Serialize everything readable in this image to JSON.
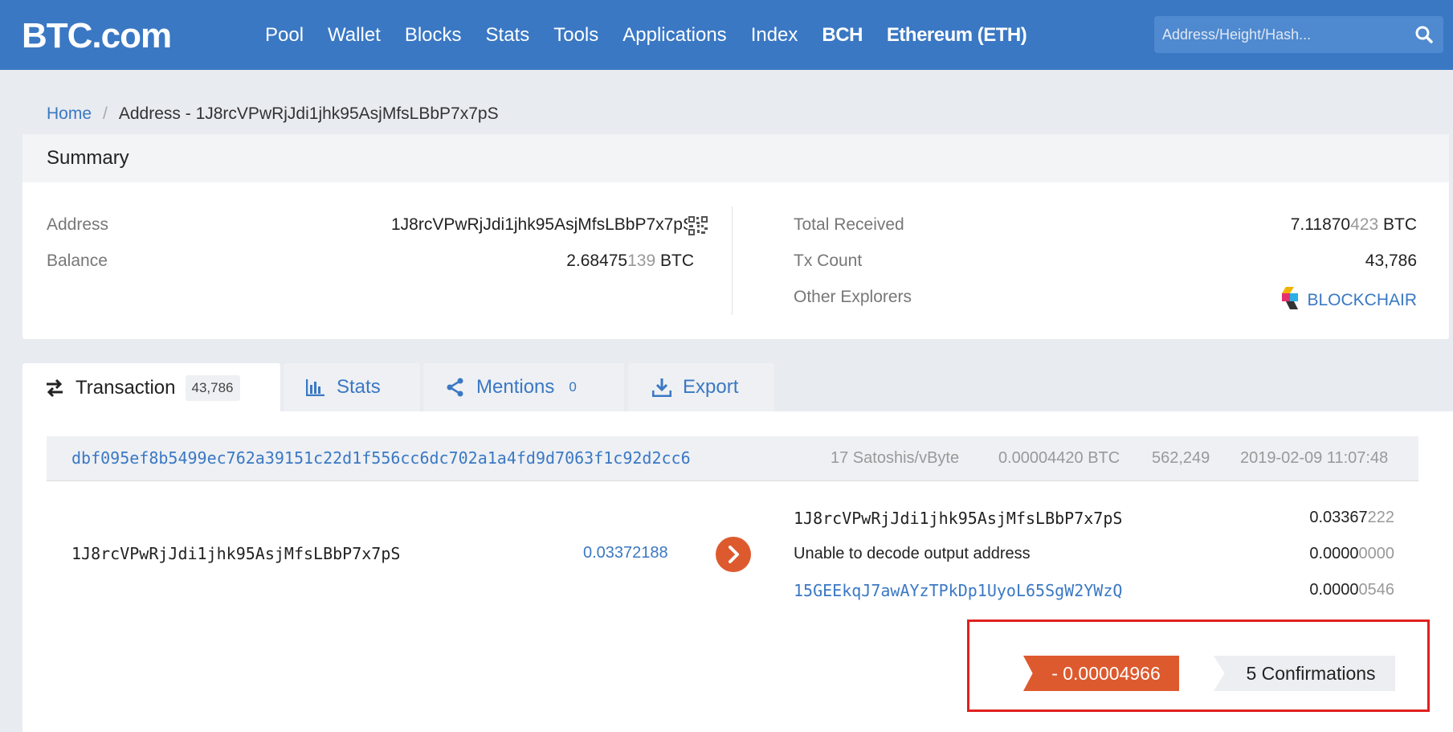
{
  "header": {
    "logo": "BTC.com",
    "nav": [
      "Pool",
      "Wallet",
      "Blocks",
      "Stats",
      "Tools",
      "Applications",
      "Index",
      "BCH",
      "Ethereum (ETH)"
    ],
    "search_placeholder": "Address/Height/Hash..."
  },
  "breadcrumb": {
    "home": "Home",
    "separator": "/",
    "current": "Address - 1J8rcVPwRjJdi1jhk95AsjMfsLBbP7x7pS"
  },
  "summary": {
    "title": "Summary",
    "address_label": "Address",
    "address_value": "1J8rcVPwRjJdi1jhk95AsjMfsLBbP7x7pS",
    "balance_label": "Balance",
    "balance_main": "2.68475",
    "balance_dim": "139",
    "balance_unit": " BTC",
    "total_received_label": "Total Received",
    "total_received_main": "7.11870",
    "total_received_dim": "423",
    "total_received_unit": " BTC",
    "tx_count_label": "Tx Count",
    "tx_count_value": "43,786",
    "other_explorers_label": "Other Explorers",
    "other_explorers_value": "BLOCKCHAIR"
  },
  "tabs": {
    "transaction_label": "Transaction",
    "transaction_count": "43,786",
    "stats_label": "Stats",
    "mentions_label": "Mentions",
    "mentions_count": "0",
    "export_label": "Export"
  },
  "transaction": {
    "hash": "dbf095ef8b5499ec762a39151c22d1f556cc6dc702a1a4fd9d7063f1c92d2cc6",
    "fee_rate": "17 Satoshis/vByte",
    "fee": "0.00004420 BTC",
    "height": "562,249",
    "time": "2019-02-09 11:07:48",
    "input_address": "1J8rcVPwRjJdi1jhk95AsjMfsLBbP7x7pS",
    "input_value_main": "0.03372188",
    "outputs": [
      {
        "address": "1J8rcVPwRjJdi1jhk95AsjMfsLBbP7x7pS",
        "value_main": "0.03367",
        "value_dim": "222"
      },
      {
        "address": "Unable to decode output address",
        "value_main": "0.0000",
        "value_dim": "0000"
      },
      {
        "address": "15GEEkqJ7awAYzTPkDp1UyoL65SgW2YWzQ",
        "value_main": "0.0000",
        "value_dim": "0546"
      }
    ],
    "amount": "- 0.00004966",
    "confirmations": "5 Confirmations"
  },
  "colors": {
    "brand_blue": "#3a78c4",
    "accent_orange": "#dd5a2e",
    "highlight_red": "#e02020"
  },
  "icons": [
    "search-icon",
    "qr-code-icon",
    "blockchair-logo-icon",
    "transfer-icon",
    "bar-chart-icon",
    "share-icon",
    "download-icon",
    "chevron-right-icon"
  ]
}
